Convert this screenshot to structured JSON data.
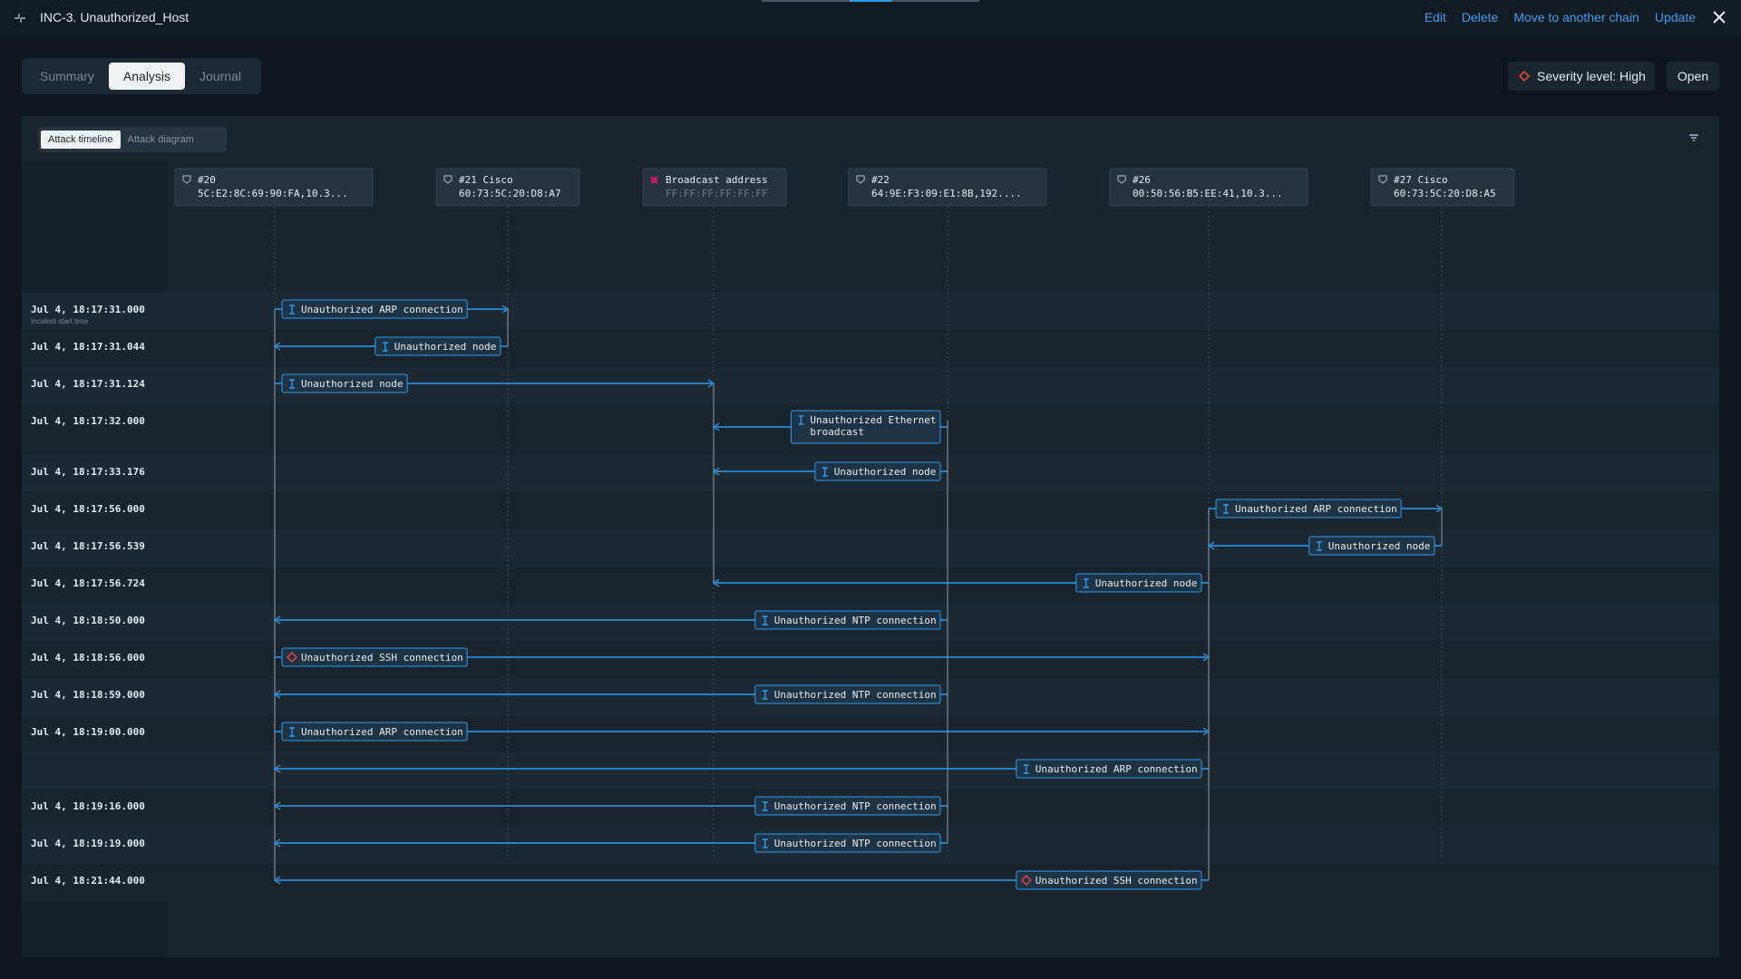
{
  "header": {
    "title": "INC-3. Unauthorized_Host",
    "actions": {
      "edit": "Edit",
      "delete": "Delete",
      "move": "Move to another chain",
      "update": "Update"
    }
  },
  "tabs": [
    "Summary",
    "Analysis",
    "Journal"
  ],
  "active_tab": "Analysis",
  "severity": {
    "label": "Severity level: High",
    "color": "#e0453a"
  },
  "status_button": "Open",
  "subtabs": [
    "Attack timeline",
    "Attack diagram"
  ],
  "active_subtab": "Attack timeline",
  "colors": {
    "accent": "#2a9df4",
    "link_text": "#3d9ef0",
    "danger": "#e0453a",
    "broadcast": "#c2185b"
  },
  "hosts": [
    {
      "id": "h20",
      "line1": "#20",
      "line2": "5C:E2:8C:69:90:FA,10.3...",
      "icon": "device-icon"
    },
    {
      "id": "h21",
      "line1": "#21 Cisco",
      "line2": "60:73:5C:20:D8:A7",
      "icon": "device-icon"
    },
    {
      "id": "hbc",
      "line1": "Broadcast address",
      "line2": "FF:FF:FF:FF:FF:FF",
      "icon": "broadcast-icon"
    },
    {
      "id": "h22",
      "line1": "#22",
      "line2": "64:9E:F3:09:E1:8B,192....",
      "icon": "device-icon"
    },
    {
      "id": "h26",
      "line1": "#26",
      "line2": "00:50:56:B5:EE:41,10.3...",
      "icon": "device-icon"
    },
    {
      "id": "h27",
      "line1": "#27 Cisco",
      "line2": "60:73:5C:20:D8:A5",
      "icon": "device-icon"
    }
  ],
  "rows": [
    {
      "time": "Jul 4, 18:17:31.000",
      "sub": "Incident start time"
    },
    {
      "time": "Jul 4, 18:17:31.044"
    },
    {
      "time": "Jul 4, 18:17:31.124"
    },
    {
      "time": "Jul 4, 18:17:32.000"
    },
    {
      "time": "Jul 4, 18:17:33.176"
    },
    {
      "time": "Jul 4, 18:17:56.000"
    },
    {
      "time": "Jul 4, 18:17:56.539"
    },
    {
      "time": "Jul 4, 18:17:56.724"
    },
    {
      "time": "Jul 4, 18:18:50.000"
    },
    {
      "time": "Jul 4, 18:18:56.000"
    },
    {
      "time": "Jul 4, 18:18:59.000"
    },
    {
      "time": "Jul 4, 18:19:00.000"
    },
    {
      "time": ""
    },
    {
      "time": "Jul 4, 18:19:16.000"
    },
    {
      "time": "Jul 4, 18:19:19.000"
    },
    {
      "time": "Jul 4, 18:21:44.000"
    }
  ],
  "events": [
    {
      "row": 0,
      "from": "h20",
      "to": "h21",
      "label": "Unauthorized ARP connection",
      "icon": "event-icon"
    },
    {
      "row": 1,
      "from": "h21",
      "to": "h20",
      "label": "Unauthorized node",
      "icon": "event-icon"
    },
    {
      "row": 2,
      "from": "h20",
      "to": "hbc",
      "label": "Unauthorized node",
      "icon": "event-icon"
    },
    {
      "row": 3,
      "from": "h22",
      "to": "hbc",
      "label": [
        "Unauthorized Ethernet",
        "broadcast"
      ],
      "icon": "event-icon"
    },
    {
      "row": 4,
      "from": "h22",
      "to": "hbc",
      "label": "Unauthorized node",
      "icon": "event-icon"
    },
    {
      "row": 5,
      "from": "h26",
      "to": "h27",
      "label": "Unauthorized ARP connection",
      "icon": "event-icon"
    },
    {
      "row": 6,
      "from": "h27",
      "to": "h26",
      "label": "Unauthorized node",
      "icon": "event-icon"
    },
    {
      "row": 7,
      "from": "h26",
      "to": "hbc",
      "label": "Unauthorized node",
      "icon": "event-icon"
    },
    {
      "row": 8,
      "from": "h22",
      "to": "h20",
      "label": "Unauthorized NTP connection",
      "icon": "event-icon"
    },
    {
      "row": 9,
      "from": "h20",
      "to": "h26",
      "label": "Unauthorized SSH connection",
      "icon": "danger-icon"
    },
    {
      "row": 10,
      "from": "h22",
      "to": "h20",
      "label": "Unauthorized NTP connection",
      "icon": "event-icon"
    },
    {
      "row": 11,
      "from": "h20",
      "to": "h26",
      "label": "Unauthorized ARP connection",
      "icon": "event-icon"
    },
    {
      "row": 12,
      "from": "h26",
      "to": "h20",
      "label": "Unauthorized ARP connection",
      "icon": "event-icon"
    },
    {
      "row": 13,
      "from": "h22",
      "to": "h20",
      "label": "Unauthorized NTP connection",
      "icon": "event-icon"
    },
    {
      "row": 14,
      "from": "h22",
      "to": "h20",
      "label": "Unauthorized NTP connection",
      "icon": "event-icon"
    },
    {
      "row": 15,
      "from": "h26",
      "to": "h20",
      "label": "Unauthorized SSH connection",
      "icon": "danger-icon"
    }
  ]
}
